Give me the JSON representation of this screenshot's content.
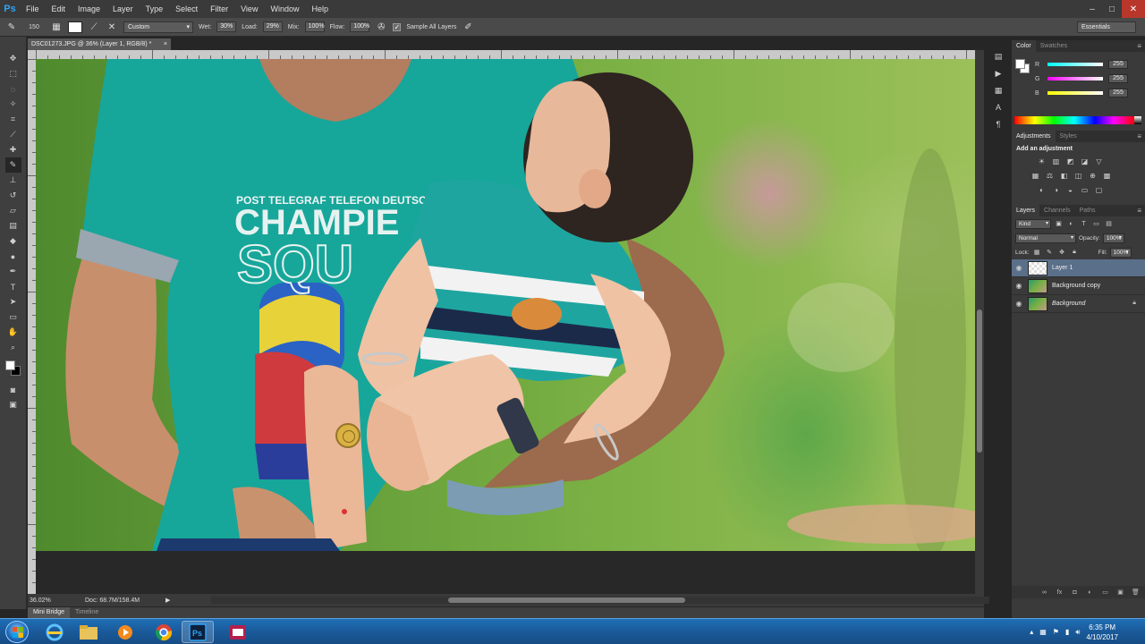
{
  "app": {
    "logo": "Ps"
  },
  "menu": [
    "File",
    "Edit",
    "Image",
    "Layer",
    "Type",
    "Select",
    "Filter",
    "View",
    "Window",
    "Help"
  ],
  "window_controls": {
    "minimize": "–",
    "maximize": "□",
    "close": "✕"
  },
  "options_bar": {
    "brush_size": "150",
    "preset": "Custom",
    "wet_label": "Wet:",
    "wet_value": "30%",
    "load_label": "Load:",
    "load_value": "29%",
    "mix_label": "Mix:",
    "mix_value": "100%",
    "flow_label": "Flow:",
    "flow_value": "100%",
    "sample_all_layers": "Sample All Layers",
    "workspace": "Essentials"
  },
  "document": {
    "tab_title": "DSC01273.JPG @ 36% (Layer 1, RGB/8) *",
    "close": "×",
    "shirt_text_line1": "POST TELEGRAF TELEFON DEUTSCHE BUNDESPOST",
    "shirt_text_line2": "CHAMPIE",
    "shirt_text_line3": "SQU"
  },
  "status": {
    "zoom": "36.02%",
    "doc_info": "Doc: 68.7M/158.4M",
    "arrow": "▶"
  },
  "bottom_tabs": [
    "Mini Bridge",
    "Timeline"
  ],
  "panels": {
    "color": {
      "tabs": [
        "Color",
        "Swatches"
      ],
      "sliders": [
        {
          "label": "R",
          "value": "255",
          "gradient": "linear-gradient(90deg,#00ffff,#ffffff)"
        },
        {
          "label": "G",
          "value": "255",
          "gradient": "linear-gradient(90deg,#ff00ff,#ffffff)"
        },
        {
          "label": "B",
          "value": "255",
          "gradient": "linear-gradient(90deg,#ffff00,#ffffff)"
        }
      ]
    },
    "adjustments": {
      "tabs": [
        "Adjustments",
        "Styles"
      ],
      "title": "Add an adjustment"
    },
    "layers": {
      "tabs": [
        "Layers",
        "Channels",
        "Paths"
      ],
      "kind": "Kind",
      "blend_mode": "Normal",
      "opacity_label": "Opacity:",
      "opacity_value": "100%",
      "lock_label": "Lock:",
      "fill_label": "Fill:",
      "fill_value": "100%",
      "items": [
        {
          "name": "Layer 1",
          "selected": true,
          "thumb": "transparent"
        },
        {
          "name": "Background copy",
          "selected": false,
          "thumb": "img"
        },
        {
          "name": "Background",
          "selected": false,
          "thumb": "img",
          "locked": true
        }
      ]
    }
  },
  "taskbar": {
    "clock_time": "6:35 PM",
    "clock_date": "4/10/2017"
  },
  "colors": {
    "accent": "#2fa3f6",
    "selected_layer": "#5a6f89",
    "taskbar": "#1a5a9a"
  }
}
